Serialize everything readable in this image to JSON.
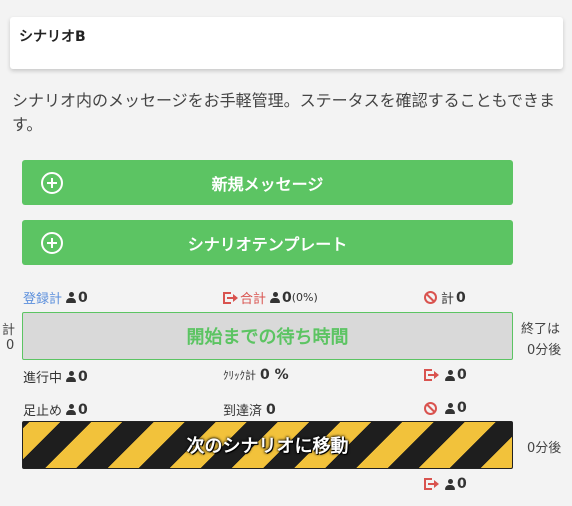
{
  "scenario": {
    "title": "シナリオB"
  },
  "description": "シナリオ内のメッセージをお手軽管理。ステータスを確認することもできます。",
  "buttons": {
    "new_message": "新規メッセージ",
    "scenario_template": "シナリオテンプレート"
  },
  "stats_header": {
    "registered_label": "登録計",
    "registered_count": "0",
    "left_total_label": "合計",
    "left_total_count": "0",
    "left_total_pct": "(0%)",
    "blocked_label": "計",
    "blocked_count": "0"
  },
  "side_left": {
    "label": "計",
    "value": "0"
  },
  "side_right": {
    "label": "終了は",
    "value": "0分後"
  },
  "wait_bar": {
    "label": "開始までの待ち時間"
  },
  "stats_row1": {
    "in_progress_label": "進行中",
    "in_progress_count": "0",
    "click_label": "ｸﾘｯｸ計",
    "click_value": "0 %",
    "exit_count": "0"
  },
  "stats_row2": {
    "stopped_label": "足止め",
    "stopped_count": "0",
    "reached_label": "到達済",
    "reached_count": "0",
    "blocked_count": "0"
  },
  "move_bar": {
    "label": "次のシナリオに移動",
    "after": "0分後"
  },
  "footer": {
    "exit_count": "0"
  }
}
